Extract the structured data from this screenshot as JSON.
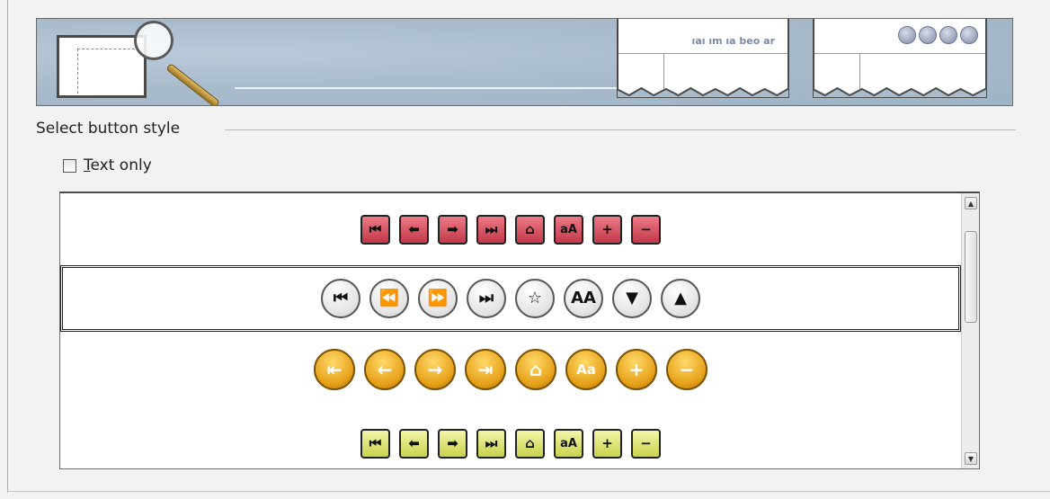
{
  "banner": {
    "preview_text": "ıaı ım ıa beo ar",
    "preview_buttons": [
      "first-icon",
      "prev-icon",
      "next-icon",
      "last-icon"
    ]
  },
  "section": {
    "label": "Select button style"
  },
  "text_only": {
    "mnemonic": "T",
    "rest": "ext only",
    "checked": false
  },
  "styles": {
    "rows": [
      {
        "style": "red-square",
        "buttons": [
          {
            "icon": "first-icon",
            "glyph": "⏮"
          },
          {
            "icon": "back-icon",
            "glyph": "⬅"
          },
          {
            "icon": "forward-icon",
            "glyph": "➡"
          },
          {
            "icon": "last-icon",
            "glyph": "⏭"
          },
          {
            "icon": "home-icon",
            "glyph": "⌂"
          },
          {
            "icon": "font-size-icon",
            "glyph": "aA"
          },
          {
            "icon": "plus-icon",
            "glyph": "+"
          },
          {
            "icon": "minus-icon",
            "glyph": "−"
          }
        ]
      },
      {
        "style": "grey-round",
        "selected": true,
        "buttons": [
          {
            "icon": "first-icon",
            "glyph": "⏮"
          },
          {
            "icon": "back-icon",
            "glyph": "⏪"
          },
          {
            "icon": "forward-icon",
            "glyph": "⏩"
          },
          {
            "icon": "last-icon",
            "glyph": "⏭"
          },
          {
            "icon": "star-icon",
            "glyph": "☆"
          },
          {
            "icon": "font-size-icon",
            "glyph": "AA"
          },
          {
            "icon": "down-icon",
            "glyph": "▼"
          },
          {
            "icon": "up-icon",
            "glyph": "▲"
          }
        ]
      },
      {
        "style": "orange-round",
        "buttons": [
          {
            "icon": "first-icon",
            "glyph": "⇤"
          },
          {
            "icon": "back-icon",
            "glyph": "←"
          },
          {
            "icon": "forward-icon",
            "glyph": "→"
          },
          {
            "icon": "last-icon",
            "glyph": "⇥"
          },
          {
            "icon": "home-icon",
            "glyph": "⌂"
          },
          {
            "icon": "font-size-icon",
            "glyph": "Aa"
          },
          {
            "icon": "plus-icon",
            "glyph": "+"
          },
          {
            "icon": "minus-icon",
            "glyph": "−"
          }
        ]
      },
      {
        "style": "lime-square",
        "buttons": [
          {
            "icon": "first-icon",
            "glyph": "⏮"
          },
          {
            "icon": "back-icon",
            "glyph": "⬅"
          },
          {
            "icon": "forward-icon",
            "glyph": "➡"
          },
          {
            "icon": "last-icon",
            "glyph": "⏭"
          },
          {
            "icon": "home-icon",
            "glyph": "⌂"
          },
          {
            "icon": "font-size-icon",
            "glyph": "aA"
          },
          {
            "icon": "plus-icon",
            "glyph": "+"
          },
          {
            "icon": "minus-icon",
            "glyph": "−"
          }
        ]
      }
    ]
  },
  "scrollbar": {
    "up_icon": "scroll-up-icon",
    "down_icon": "scroll-down-icon"
  },
  "colors": {
    "red": "#d4505f",
    "orange": "#e6a11a",
    "lime": "#dde477",
    "banner": "#a9bccc"
  }
}
